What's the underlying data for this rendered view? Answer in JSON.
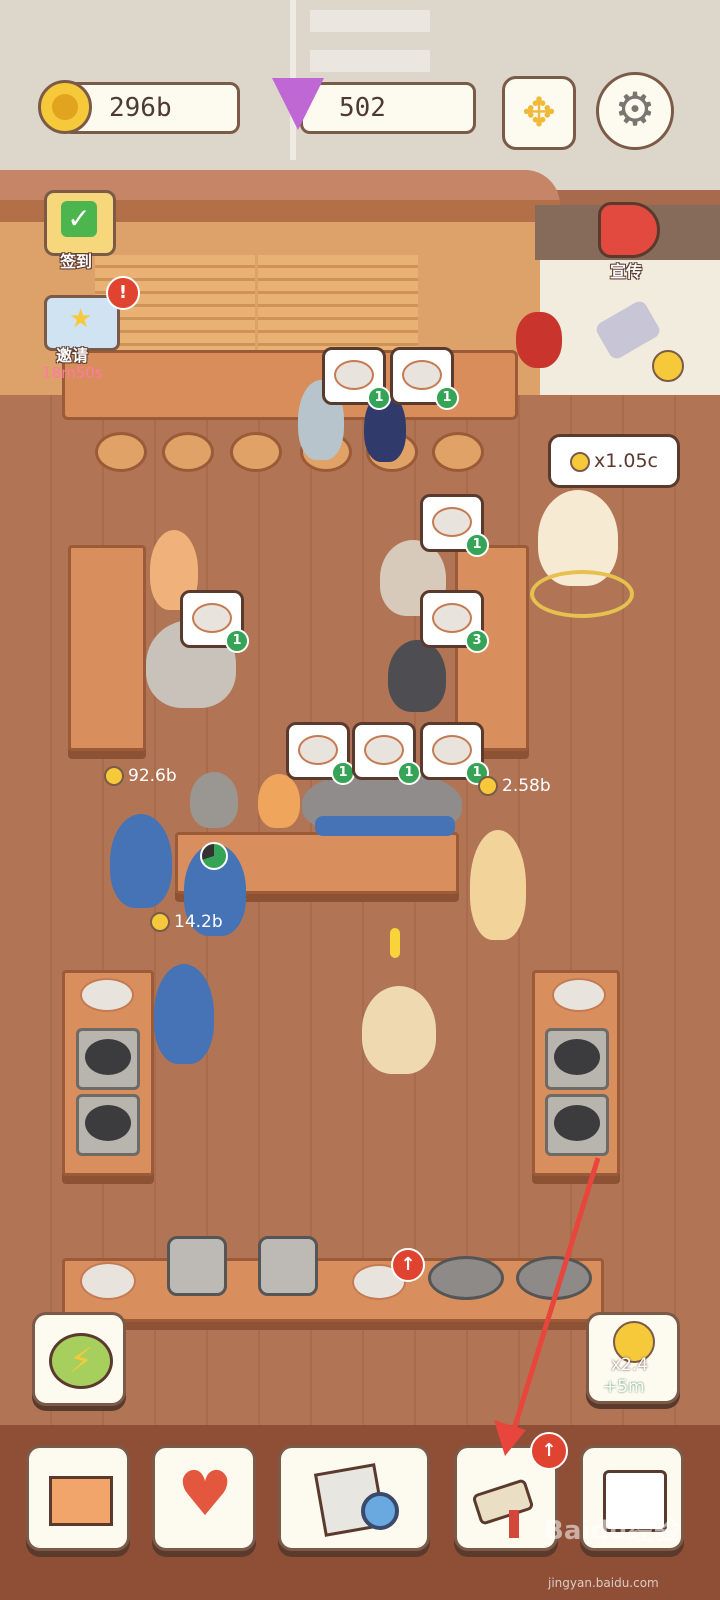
{
  "hud": {
    "coins": "296b",
    "gems": "502",
    "expand_icon": "arrows-icon",
    "settings_icon": "gear-icon"
  },
  "side_buttons": {
    "checkin_label": "签到",
    "invite_label": "邀请",
    "invite_timer": "18m50s",
    "promote_label": "宣传"
  },
  "customer_tip": "x1.05c",
  "orders": [
    {
      "count": "1"
    },
    {
      "count": "1"
    },
    {
      "count": "1"
    },
    {
      "count": "1"
    },
    {
      "count": "3"
    },
    {
      "count": "1"
    },
    {
      "count": "1"
    },
    {
      "count": "1"
    }
  ],
  "earnings": {
    "left_table": "92.6b",
    "right_table": "2.58b",
    "lower_left": "14.2b"
  },
  "boost": {
    "multiplier": "x2.4",
    "duration": "+5m"
  },
  "bottom_nav": [
    {
      "name": "shop",
      "icon": "storefront-icon"
    },
    {
      "name": "favorites",
      "icon": "heart-paw-icon"
    },
    {
      "name": "research",
      "icon": "newspaper-magnifier-icon"
    },
    {
      "name": "upgrade",
      "icon": "paint-roller-icon"
    },
    {
      "name": "outfits",
      "icon": "shirt-icon"
    }
  ],
  "watermark": {
    "brand": "Baidu经验",
    "url": "jingyan.baidu.com"
  },
  "colors": {
    "floor": "#b17556",
    "panel": "#fdfaf0",
    "outline": "#7b5a48",
    "badge_green": "#35a456",
    "alert_red": "#e0432f",
    "arrow_red": "#e8453c"
  }
}
